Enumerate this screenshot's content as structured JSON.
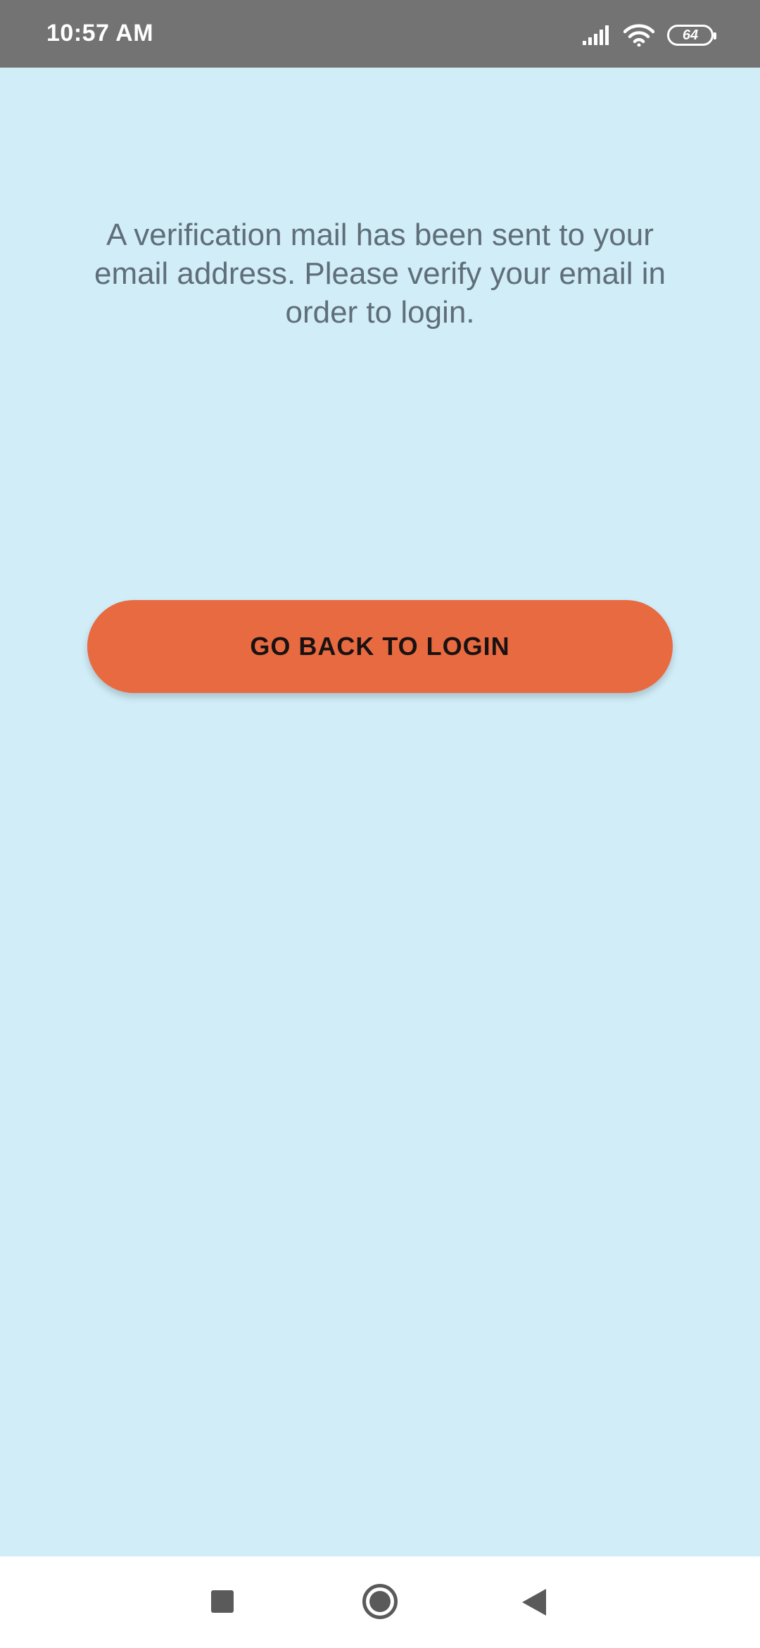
{
  "status_bar": {
    "time": "10:57 AM",
    "battery_level": "64",
    "icons": [
      "signal-icon",
      "wifi-icon",
      "battery-icon"
    ]
  },
  "main": {
    "message": "A verification mail has been sent to your email address. Please verify your email in order to login.",
    "back_button_label": "GO BACK TO LOGIN"
  },
  "nav_bar": {
    "icons": [
      "recents-icon",
      "home-icon",
      "back-icon"
    ]
  },
  "colors": {
    "background": "#d0edf8",
    "status_bar": "#737373",
    "button": "#e86a40",
    "button_text": "#1a1212",
    "message_text": "#5f6e78"
  }
}
